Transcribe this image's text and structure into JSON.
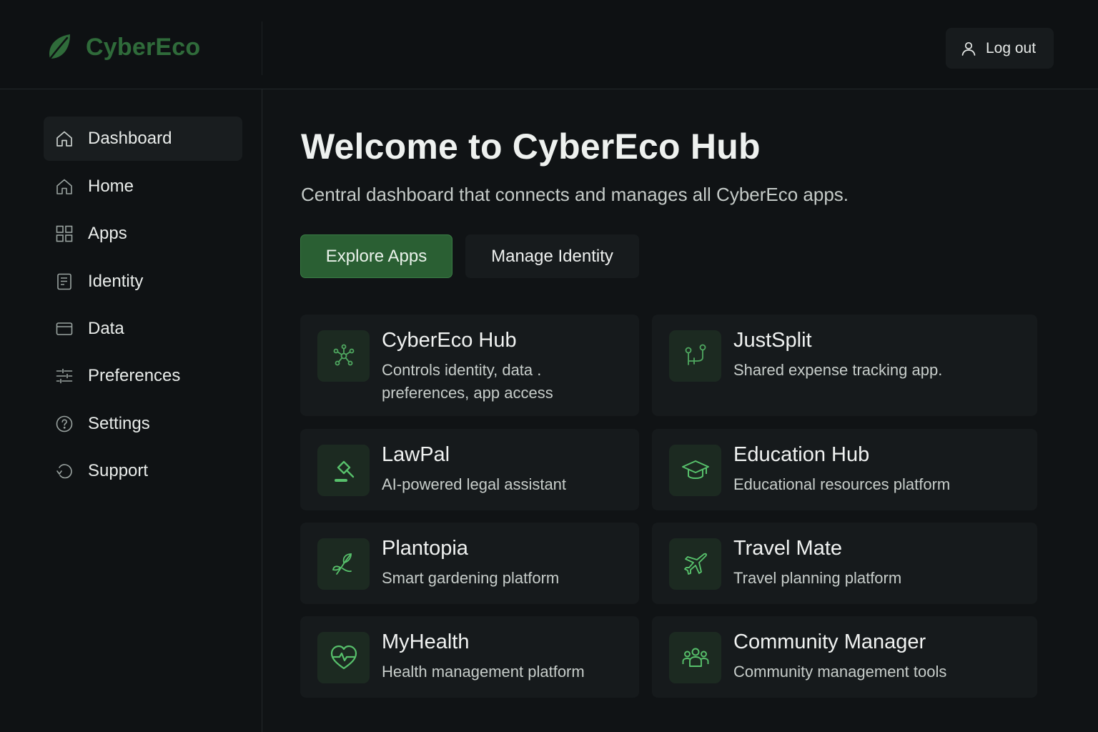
{
  "brand": {
    "name": "CyberEco",
    "color": "#2f6b3a",
    "icon": "leaf-icon"
  },
  "header": {
    "logout_label": "Log out",
    "logout_icon": "user-icon"
  },
  "sidebar": {
    "items": [
      {
        "label": "Dashboard",
        "icon": "home-icon",
        "active": true
      },
      {
        "label": "Home",
        "icon": "home-icon"
      },
      {
        "label": "Apps",
        "icon": "grid-icon"
      },
      {
        "label": "Identity",
        "icon": "id-card-icon"
      },
      {
        "label": "Data",
        "icon": "card-icon"
      },
      {
        "label": "Preferences",
        "icon": "sliders-icon"
      },
      {
        "label": "Settings",
        "icon": "help-circle-icon"
      },
      {
        "label": "Support",
        "icon": "refresh-icon"
      }
    ]
  },
  "main": {
    "title": "Welcome to CyberEco Hub",
    "subtitle": "Central dashboard that connects and manages all CyberEco apps.",
    "primary_button": "Explore Apps",
    "secondary_button": "Manage Identity",
    "accent_color": "#2a5f33",
    "apps": [
      {
        "title": "CyberEco Hub",
        "desc": "Controls identity, data . preferences, app access",
        "icon": "network-icon"
      },
      {
        "title": "JustSplit",
        "desc": "Shared expense tracking app.",
        "icon": "split-icon"
      },
      {
        "title": "LawPal",
        "desc": "AI-powered legal assistant",
        "icon": "gavel-icon"
      },
      {
        "title": "Education Hub",
        "desc": "Educational resources platform",
        "icon": "graduation-cap-icon"
      },
      {
        "title": "Plantopia",
        "desc": "Smart gardening platform",
        "icon": "sprout-icon"
      },
      {
        "title": "Travel Mate",
        "desc": "Travel planning platform",
        "icon": "plane-icon"
      },
      {
        "title": "MyHealth",
        "desc": "Health management platform",
        "icon": "heart-pulse-icon"
      },
      {
        "title": "Community Manager",
        "desc": "Community management tools",
        "icon": "users-icon"
      }
    ]
  }
}
